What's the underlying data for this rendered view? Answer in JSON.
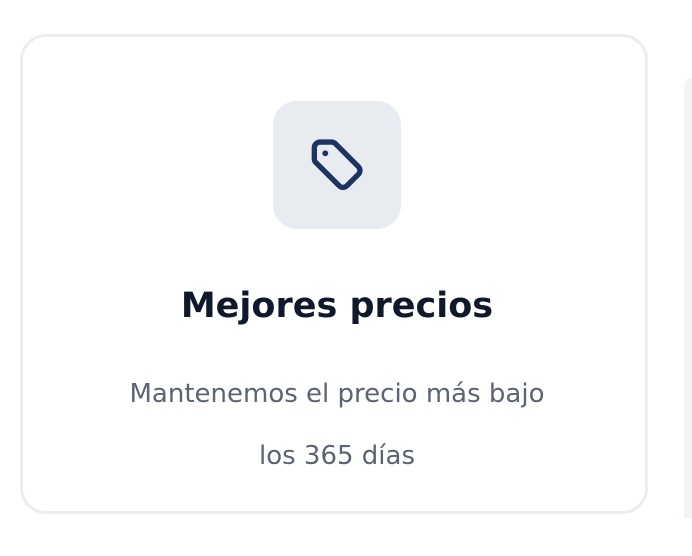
{
  "feature_card": {
    "icon": "price-tag-icon",
    "icon_color": "#1b3461",
    "icon_tile_color": "#e8ebf0",
    "title": "Mejores precios",
    "description_lines": [
      "Mantenemos el precio más bajo",
      "los 365 días"
    ]
  }
}
